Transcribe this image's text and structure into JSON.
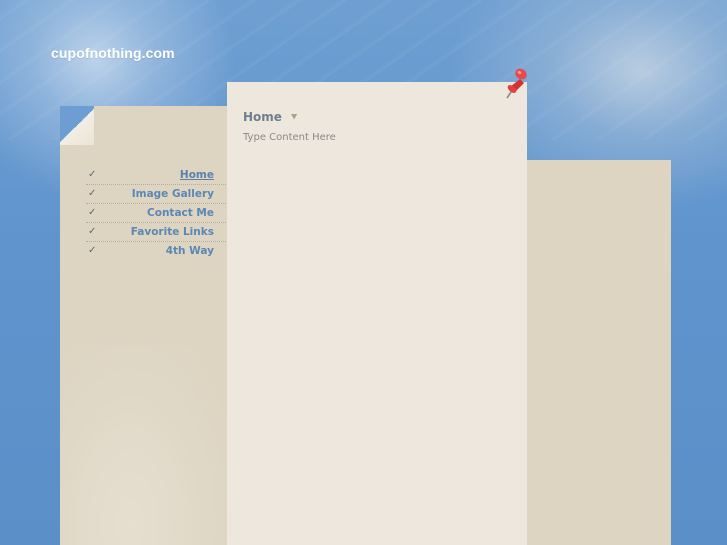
{
  "site": {
    "title": "cupofnothing.com"
  },
  "nav": {
    "items": [
      {
        "label": "Home",
        "active": true
      },
      {
        "label": "Image Gallery",
        "active": false
      },
      {
        "label": "Contact Me",
        "active": false
      },
      {
        "label": "Favorite Links",
        "active": false
      },
      {
        "label": "4th Way",
        "active": false
      }
    ],
    "item_icon": "check-icon"
  },
  "content": {
    "title": "Home",
    "title_icon": "chevron-down-icon",
    "text": "Type Content Here"
  },
  "decor": {
    "pin_icon": "pushpin-icon",
    "pin_color": "#e03a3a"
  },
  "colors": {
    "background": "#5f95cc",
    "sidebar_paper": "#ddd4c1",
    "content_paper": "#ede7dd",
    "nav_link": "#5a87b6",
    "title_text": "#6f7f8e"
  }
}
